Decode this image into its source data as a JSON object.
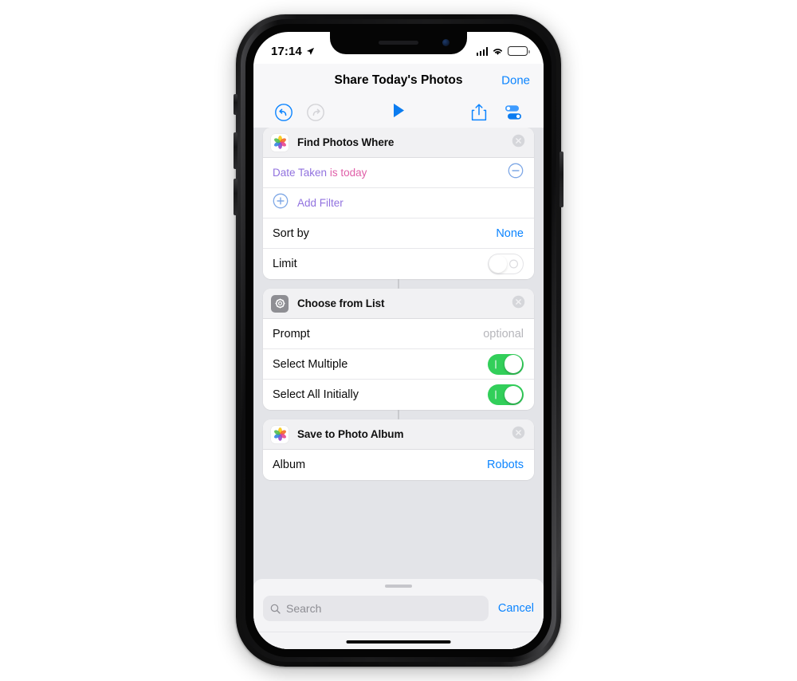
{
  "status_bar": {
    "time": "17:14",
    "location_icon": "location-arrow-icon",
    "signal_icon": "cellular-signal-icon",
    "wifi_icon": "wifi-icon",
    "battery_icon": "battery-icon"
  },
  "nav": {
    "title": "Share Today's Photos",
    "done_label": "Done"
  },
  "toolbar": {
    "undo_icon": "undo-icon",
    "redo_icon": "redo-icon",
    "play_icon": "play-icon",
    "share_icon": "share-icon",
    "settings_icon": "shortcut-settings-icon"
  },
  "cards": [
    {
      "title": "Find Photos Where",
      "icon": "photos-app-icon",
      "close_icon": "close-icon",
      "filter": {
        "key": "Date Taken",
        "operator": "is",
        "value": "today",
        "remove_icon": "minus-circle-icon"
      },
      "add_filter": {
        "label": "Add Filter",
        "icon": "plus-circle-icon"
      },
      "rows": [
        {
          "label": "Sort by",
          "value": "None",
          "type": "link"
        },
        {
          "label": "Limit",
          "value": "off",
          "type": "toggle"
        }
      ]
    },
    {
      "title": "Choose from List",
      "icon": "gear-icon",
      "close_icon": "close-icon",
      "rows": [
        {
          "label": "Prompt",
          "value": "optional",
          "type": "placeholder"
        },
        {
          "label": "Select Multiple",
          "value": "on",
          "type": "toggle"
        },
        {
          "label": "Select All Initially",
          "value": "on",
          "type": "toggle"
        }
      ]
    },
    {
      "title": "Save to Photo Album",
      "icon": "photos-app-icon",
      "close_icon": "close-icon",
      "rows": [
        {
          "label": "Album",
          "value": "Robots",
          "type": "link"
        }
      ]
    }
  ],
  "search_sheet": {
    "grabber": "sheet-grabber",
    "search_icon": "search-icon",
    "placeholder": "Search",
    "cancel_label": "Cancel"
  },
  "colors": {
    "accent_blue": "#0b84ff",
    "toggle_green": "#32cf5a",
    "filter_key_purple": "#9172df",
    "filter_value_pink": "#e05fa8",
    "content_bg": "#e3e4e8",
    "navbar_bg": "#f7f7f9"
  }
}
